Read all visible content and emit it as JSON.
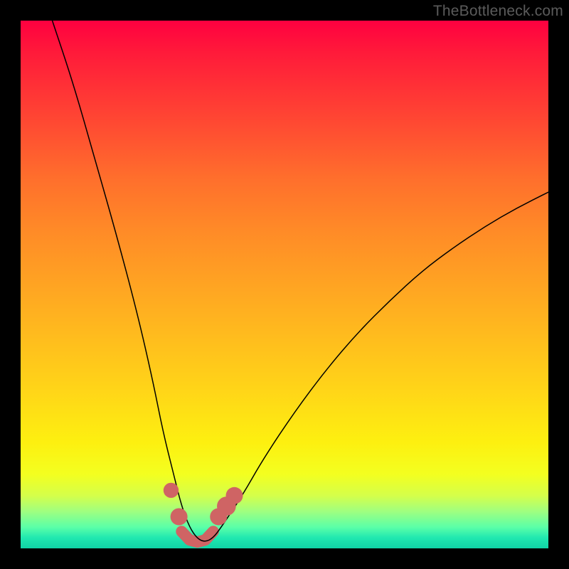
{
  "watermark": "TheBottleneck.com",
  "colors": {
    "gradient_top": "#ff0040",
    "gradient_mid": "#ffd518",
    "gradient_bottom": "#10d4a6",
    "curve": "#000000",
    "markers": "#cf6464",
    "frame": "#000000"
  },
  "chart_data": {
    "type": "line",
    "title": "",
    "xlabel": "",
    "ylabel": "",
    "xlim": [
      0,
      100
    ],
    "ylim": [
      0,
      100
    ],
    "grid": false,
    "legend": false,
    "series": [
      {
        "name": "bottleneck-curve",
        "x": [
          6,
          10,
          14,
          18,
          22,
          25,
          27,
          29,
          30.5,
          32,
          33.5,
          35,
          36.5,
          38,
          42,
          46,
          52,
          58,
          64,
          70,
          76,
          82,
          88,
          94,
          100
        ],
        "y": [
          100,
          88,
          74,
          60,
          45,
          32,
          22,
          14,
          8,
          4,
          1.8,
          1.2,
          2,
          4,
          10,
          17,
          26,
          34,
          41,
          47,
          52.5,
          57,
          61,
          64.5,
          67.5
        ]
      }
    ],
    "markers": [
      {
        "x": 28.5,
        "y": 11,
        "r": 1.0
      },
      {
        "x": 30.0,
        "y": 6,
        "r": 1.2
      },
      {
        "x": 37.5,
        "y": 6,
        "r": 1.2
      },
      {
        "x": 39.0,
        "y": 8,
        "r": 1.4
      },
      {
        "x": 40.5,
        "y": 10,
        "r": 1.2
      }
    ],
    "trough": {
      "x": [
        30.5,
        32,
        33.5,
        35,
        36.5
      ],
      "y": [
        3.2,
        1.6,
        1.2,
        1.6,
        3.2
      ]
    }
  }
}
